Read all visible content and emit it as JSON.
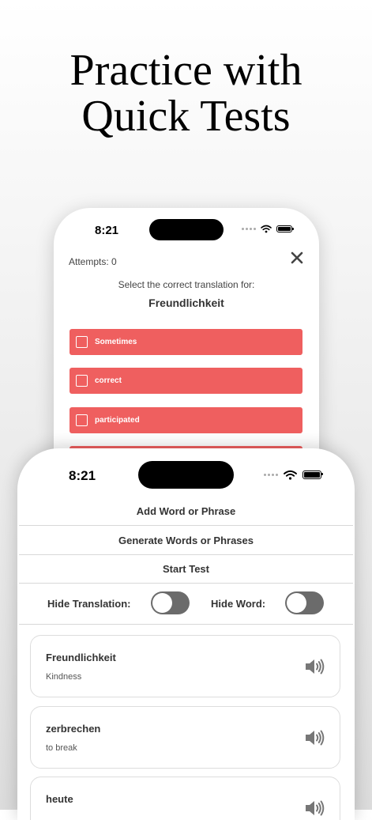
{
  "headline": {
    "line1": "Practice with",
    "line2": "Quick Tests"
  },
  "test_screen": {
    "status_time": "8:21",
    "attempts": "Attempts: 0",
    "prompt": "Select the correct translation for:",
    "target_word": "Freundlichkeit",
    "options": [
      {
        "label": "Sometimes"
      },
      {
        "label": "correct"
      },
      {
        "label": "participated"
      }
    ],
    "option_color": "#ef5f5f"
  },
  "main_screen": {
    "status_time": "8:21",
    "menu": {
      "add": "Add Word or Phrase",
      "generate": "Generate Words or Phrases",
      "start": "Start Test"
    },
    "toggles": {
      "hide_translation_label": "Hide Translation:",
      "hide_word_label": "Hide Word:",
      "hide_translation_on": false,
      "hide_word_on": false
    },
    "words": [
      {
        "word": "Freundlichkeit",
        "translation": "Kindness"
      },
      {
        "word": "zerbrechen",
        "translation": "to break"
      },
      {
        "word": "heute",
        "translation": ""
      }
    ]
  },
  "icons": {
    "close": "close-icon",
    "speaker": "speaker-icon",
    "wifi": "wifi-icon",
    "battery": "battery-icon",
    "checkbox": "checkbox-icon"
  }
}
